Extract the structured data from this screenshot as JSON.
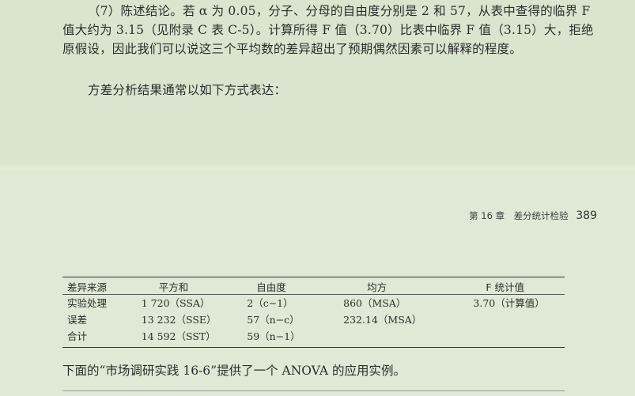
{
  "paragraph1": "（7）陈述结论。若 α 为 0.05，分子、分母的自由度分别是 2 和 57，从表中查得的临界 F 值大约为 3.15（见附录 C 表 C-5）。计算所得 F 值（3.70）比表中临界 F 值（3.15）大，拒绝原假设，因此我们可以说这三个平均数的差异超出了预期偶然因素可以解释的程度。",
  "paragraph2": "方差分析结果通常以如下方式表达：",
  "running_head": {
    "chapter": "第 16 章　差分统计检验",
    "page_number": "389"
  },
  "table": {
    "headers": [
      "差异来源",
      "平方和",
      "自由度",
      "均方",
      "F 统计值"
    ],
    "rows": [
      [
        "实验处理",
        "1 720（SSA）",
        "2（c−1）",
        "860（MSA）",
        "3.70（计算值）"
      ],
      [
        "误差",
        "13 232（SSE）",
        "57（n−c）",
        "232.14（MSA）",
        ""
      ],
      [
        "合计",
        "14 592（SST）",
        "59（n−1）",
        "",
        ""
      ]
    ]
  },
  "note": "下面的“市场调研实践 16-6”提供了一个 ANOVA 的应用实例。"
}
